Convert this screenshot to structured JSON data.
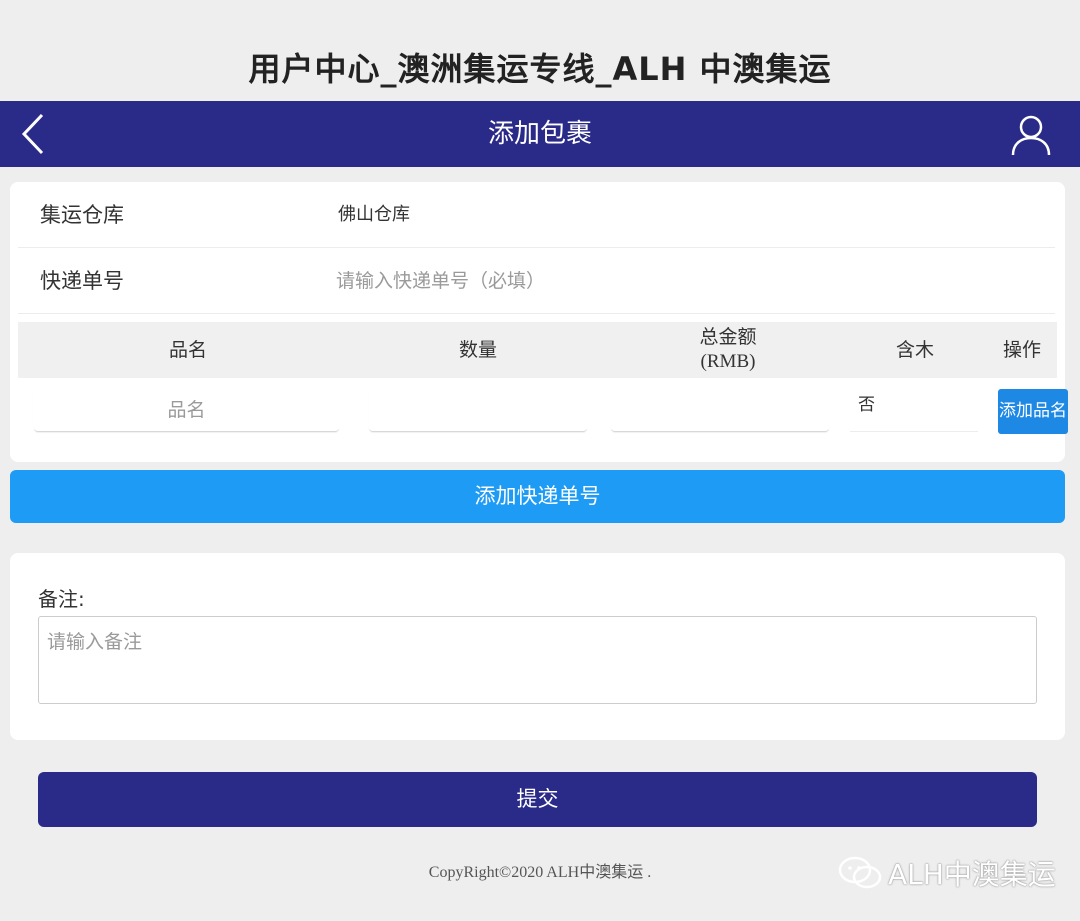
{
  "page_title": "用户中心_澳洲集运专线_ALH 中澳集运",
  "navbar": {
    "title": "添加包裹",
    "bg_color": "#2a2a88"
  },
  "form": {
    "warehouse_label": "集运仓库",
    "warehouse_value": "佛山仓库",
    "tracking_label": "快递单号",
    "tracking_placeholder": "请输入快递单号（必填）"
  },
  "table": {
    "headers": {
      "name": "品名",
      "quantity": "数量",
      "total": "总金额",
      "total_unit": "(RMB)",
      "wood": "含木",
      "action": "操作"
    },
    "row": {
      "name_placeholder": "品名",
      "wood_value": "否",
      "add_item_label": "添加品名"
    }
  },
  "add_tracking_label": "添加快递单号",
  "remark": {
    "label": "备注:",
    "placeholder": "请输入备注"
  },
  "submit_label": "提交",
  "copyright": "CopyRight©2020 ALH中澳集运 .",
  "watermark": "ALH中澳集运",
  "colors": {
    "primary": "#2a2a88",
    "accent_blue": "#1e9bf5",
    "button_blue": "#1e88e5"
  }
}
